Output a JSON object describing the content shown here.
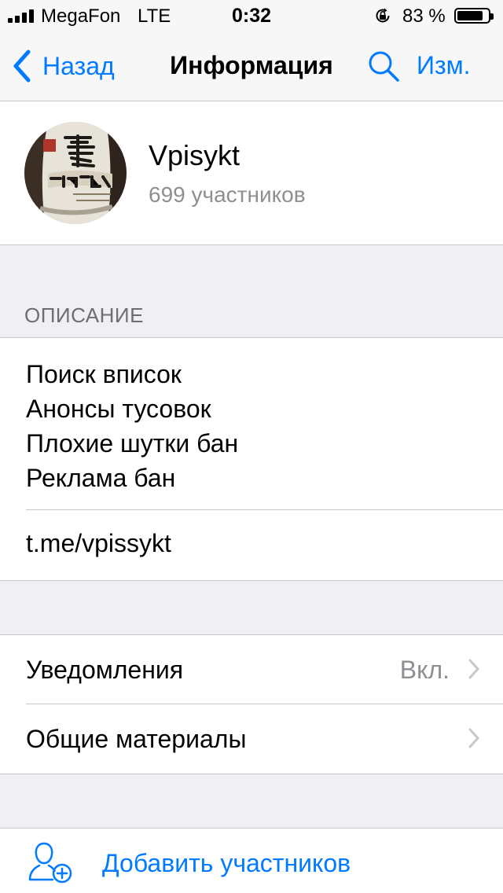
{
  "status_bar": {
    "carrier": "MegaFon",
    "network": "LTE",
    "time": "0:32",
    "battery_percent": "83 %",
    "battery_level": 0.83,
    "signal_bars": 4
  },
  "nav": {
    "back_label": "Назад",
    "title": "Информация",
    "edit_label": "Изм."
  },
  "profile": {
    "name": "Vpisykt",
    "members": "699 участников"
  },
  "description": {
    "header": "ОПИСАНИЕ",
    "lines": [
      "Поиск вписок",
      "Анонсы тусовок",
      "Плохие шутки бан",
      "Реклама бан"
    ],
    "link": "t.me/vpissykt"
  },
  "settings": {
    "notifications_label": "Уведомления",
    "notifications_value": "Вкл.",
    "shared_media_label": "Общие материалы"
  },
  "add_members_label": "Добавить участников",
  "colors": {
    "accent": "#007aff",
    "secondary_text": "#8e8e93",
    "grouped_background": "#efeff4",
    "separator": "#c8c7cc"
  },
  "icons": {
    "back": "chevron-left-icon",
    "search": "search-icon",
    "disclosure": "chevron-right-icon",
    "add_members": "add-user-icon",
    "rotation_lock": "rotation-lock-icon"
  }
}
